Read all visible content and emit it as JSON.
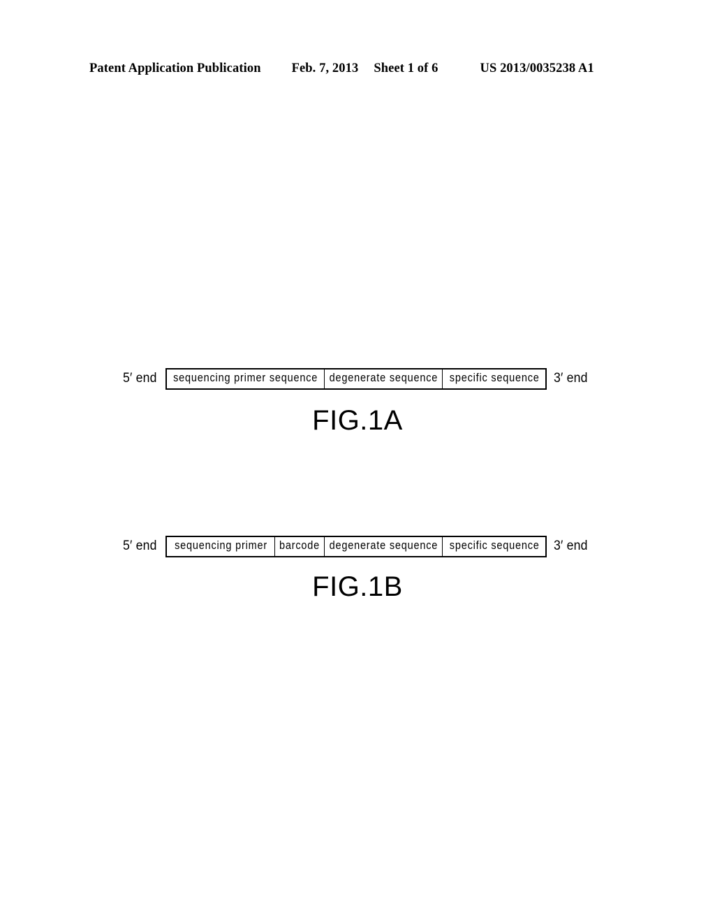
{
  "header": {
    "publication": "Patent Application Publication",
    "date": "Feb. 7, 2013",
    "sheet": "Sheet 1 of 6",
    "pub_number": "US 2013/0035238 A1"
  },
  "figures": [
    {
      "id": "fig1a",
      "caption": "FIG.1A",
      "left_end": "5′ end",
      "right_end": "3′ end",
      "segments": [
        {
          "label": "sequencing primer sequence"
        },
        {
          "label": "degenerate sequence"
        },
        {
          "label": "specific sequence"
        }
      ]
    },
    {
      "id": "fig1b",
      "caption": "FIG.1B",
      "left_end": "5′ end",
      "right_end": "3′ end",
      "segments": [
        {
          "label": "sequencing primer"
        },
        {
          "label": "barcode"
        },
        {
          "label": "degenerate sequence"
        },
        {
          "label": "specific sequence"
        }
      ]
    }
  ],
  "colors": {
    "ink": "#000000",
    "page": "#ffffff"
  }
}
